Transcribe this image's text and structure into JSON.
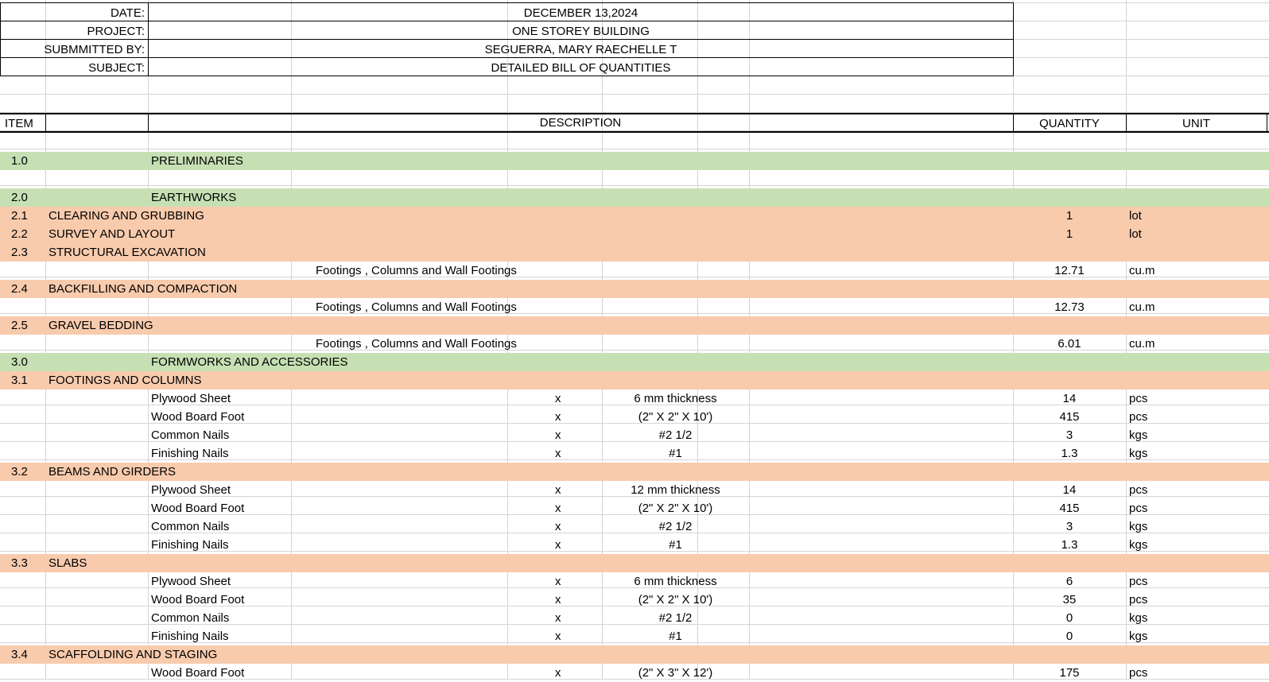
{
  "header": {
    "date_label": "DATE:",
    "date_value": "DECEMBER 13,2024",
    "project_label": "PROJECT:",
    "project_value": "ONE STOREY BUILDING",
    "submitted_label": "SUBMMITTED BY:",
    "submitted_value": "SEGUERRA, MARY RAECHELLE T",
    "subject_label": "SUBJECT:",
    "subject_value": "DETAILED BILL OF QUANTITIES"
  },
  "columns": {
    "item": "ITEM",
    "description": "DESCRIPTION",
    "quantity": "QUANTITY",
    "unit": "UNIT"
  },
  "colors": {
    "section": "#c6e0b4",
    "subsection": "#f8cbad"
  },
  "rows": [
    {
      "type": "blank"
    },
    {
      "type": "section",
      "item": "1.0",
      "title": "PRELIMINARIES"
    },
    {
      "type": "blank"
    },
    {
      "type": "section",
      "item": "2.0",
      "title": "EARTHWORKS"
    },
    {
      "type": "subsection",
      "item": "2.1",
      "title": "CLEARING AND GRUBBING",
      "qty": "1",
      "unit": "lot"
    },
    {
      "type": "subsection",
      "item": "2.2",
      "title": "SURVEY AND LAYOUT",
      "qty": "1",
      "unit": "lot"
    },
    {
      "type": "subsection",
      "item": "2.3",
      "title": "STRUCTURAL EXCAVATION"
    },
    {
      "type": "note",
      "text": "Footings , Columns and Wall Footings",
      "qty": "12.71",
      "unit": "cu.m"
    },
    {
      "type": "subsection",
      "item": "2.4",
      "title": "BACKFILLING AND COMPACTION"
    },
    {
      "type": "note",
      "text": "Footings , Columns and Wall Footings",
      "qty": "12.73",
      "unit": "cu.m"
    },
    {
      "type": "subsection",
      "item": "2.5",
      "title": "GRAVEL BEDDING"
    },
    {
      "type": "note",
      "text": "Footings , Columns and Wall Footings",
      "qty": "6.01",
      "unit": "cu.m"
    },
    {
      "type": "section",
      "item": "3.0",
      "title": "FORMWORKS AND ACCESSORIES"
    },
    {
      "type": "subsection",
      "item": "3.1",
      "title": "FOOTINGS AND COLUMNS"
    },
    {
      "type": "detail",
      "material": "Plywood Sheet",
      "x": "x",
      "spec": "6 mm thickness",
      "qty": "14",
      "unit": "pcs"
    },
    {
      "type": "detail",
      "material": "Wood Board Foot",
      "x": "x",
      "spec": "(2\" X 2\" X 10')",
      "qty": "415",
      "unit": "pcs"
    },
    {
      "type": "detail",
      "material": "Common Nails",
      "x": "x",
      "spec": "#2 1/2",
      "qty": "3",
      "unit": "kgs"
    },
    {
      "type": "detail",
      "material": "Finishing Nails",
      "x": "x",
      "spec": "#1",
      "qty": "1.3",
      "unit": "kgs"
    },
    {
      "type": "subsection",
      "item": "3.2",
      "title": "BEAMS AND GIRDERS"
    },
    {
      "type": "detail",
      "material": "Plywood Sheet",
      "x": "x",
      "spec": "12 mm thickness",
      "qty": "14",
      "unit": "pcs"
    },
    {
      "type": "detail",
      "material": "Wood Board Foot",
      "x": "x",
      "spec": "(2\" X 2\" X 10')",
      "qty": "415",
      "unit": "pcs"
    },
    {
      "type": "detail",
      "material": "Common Nails",
      "x": "x",
      "spec": "#2 1/2",
      "qty": "3",
      "unit": "kgs"
    },
    {
      "type": "detail",
      "material": "Finishing Nails",
      "x": "x",
      "spec": "#1",
      "qty": "1.3",
      "unit": "kgs"
    },
    {
      "type": "subsection",
      "item": "3.3",
      "title": "SLABS"
    },
    {
      "type": "detail",
      "material": "Plywood Sheet",
      "x": "x",
      "spec": "6 mm thickness",
      "qty": "6",
      "unit": "pcs"
    },
    {
      "type": "detail",
      "material": "Wood Board Foot",
      "x": "x",
      "spec": "(2\" X 2\" X 10')",
      "qty": "35",
      "unit": "pcs"
    },
    {
      "type": "detail",
      "material": "Common Nails",
      "x": "x",
      "spec": "#2 1/2",
      "qty": "0",
      "unit": "kgs"
    },
    {
      "type": "detail",
      "material": "Finishing Nails",
      "x": "x",
      "spec": "#1",
      "qty": "0",
      "unit": "kgs"
    },
    {
      "type": "subsection",
      "item": "3.4",
      "title": "SCAFFOLDING AND STAGING"
    },
    {
      "type": "detail",
      "material": "Wood Board Foot",
      "x": "x",
      "spec": "(2\" X 3\" X 12')",
      "qty": "175",
      "unit": "pcs"
    }
  ]
}
